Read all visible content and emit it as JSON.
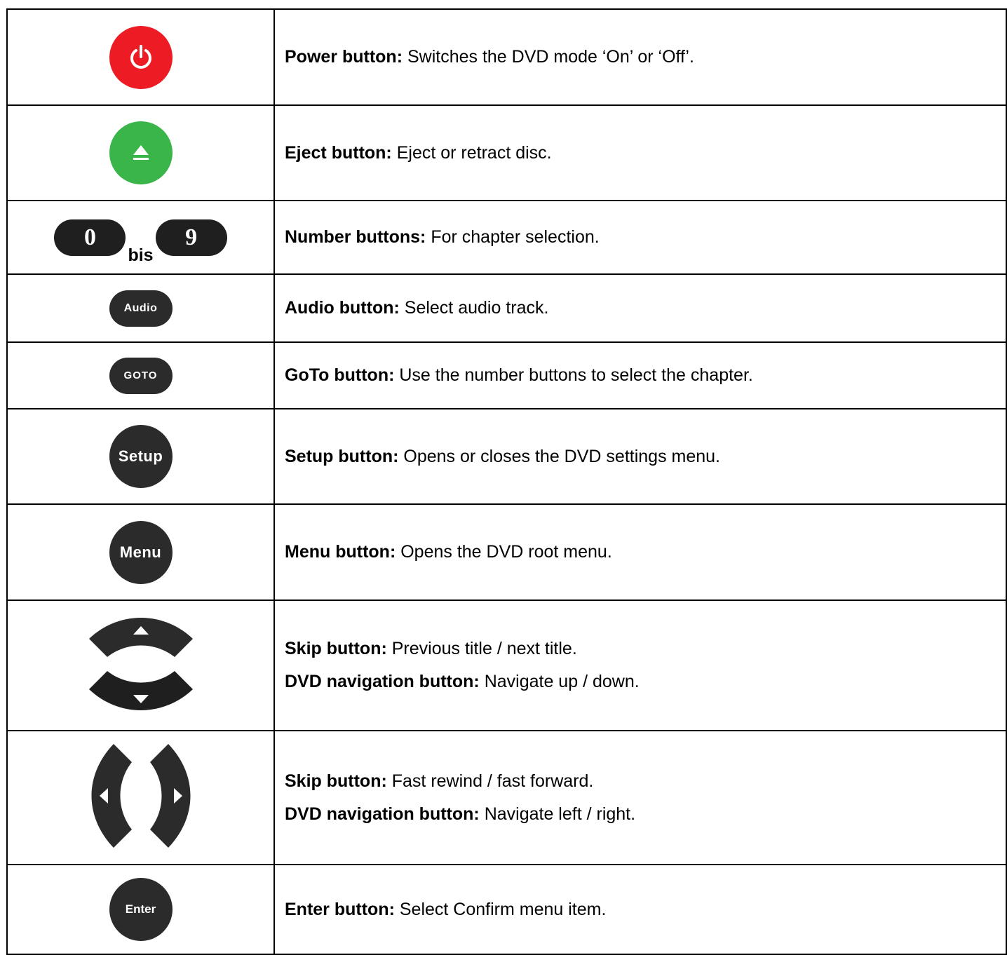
{
  "rows": [
    {
      "icon": "power-icon",
      "label": "Power button:",
      "text": " Switches the DVD mode ‘On’ or ‘Off’."
    },
    {
      "icon": "eject-icon",
      "label": "Eject button:",
      "text": " Eject or retract disc."
    },
    {
      "icon": "number-buttons-icon",
      "num_from": "0",
      "num_sep": "bis",
      "num_to": "9",
      "label": "Number buttons:",
      "text": " For chapter selection."
    },
    {
      "icon": "audio-icon",
      "button_text": "Audio",
      "label": "Audio button:",
      "text": " Select audio track."
    },
    {
      "icon": "goto-icon",
      "button_text": "GOTO",
      "label": "GoTo button:",
      "text": " Use the number buttons to select the chapter."
    },
    {
      "icon": "setup-icon",
      "button_text": "Setup",
      "label": "Setup button:",
      "text": " Opens or closes the DVD settings menu."
    },
    {
      "icon": "menu-icon",
      "button_text": "Menu",
      "label": "Menu button:",
      "text": " Opens the DVD root menu."
    },
    {
      "icon": "up-down-icon",
      "label": "Skip button:",
      "text": " Previous title / next title.",
      "label2": "DVD navigation button:",
      "text2": " Navigate up / down."
    },
    {
      "icon": "left-right-icon",
      "label": "Skip button:",
      "text": " Fast rewind / fast forward.",
      "label2": "DVD navigation button:",
      "text2": " Navigate left / right."
    },
    {
      "icon": "enter-icon",
      "button_text": "Enter",
      "label": "Enter button:",
      "text": " Select Confirm menu item."
    }
  ],
  "colors": {
    "power": "#ed1c24",
    "eject": "#39b54a",
    "button": "#2b2b2b"
  }
}
